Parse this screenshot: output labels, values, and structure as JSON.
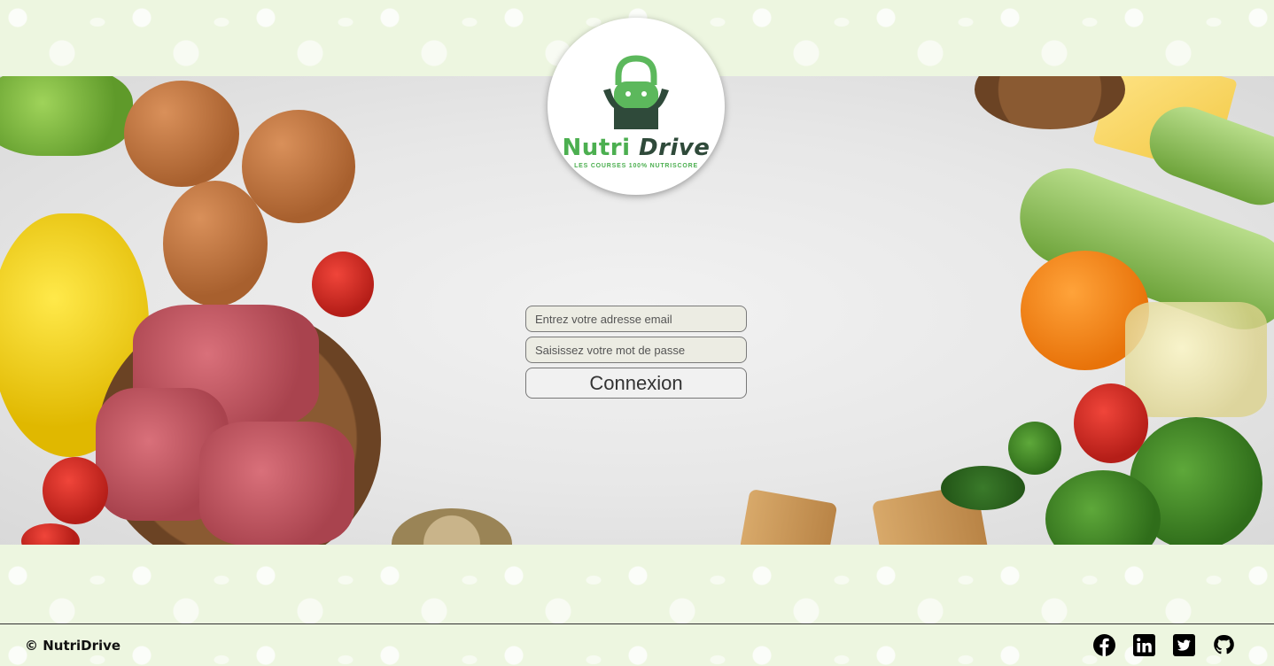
{
  "logo": {
    "brand_part1": "Nutri",
    "brand_part2": "Drive",
    "tagline": "LES COURSES 100% NUTRISCORE",
    "icon": "shopping-bag-icon",
    "colors": {
      "green": "#4caf50",
      "dark": "#2f4a3a"
    }
  },
  "login": {
    "email_placeholder": "Entrez votre adresse email",
    "password_placeholder": "Saisissez votre mot de passe",
    "submit_label": "Connexion"
  },
  "footer": {
    "copyright": "© NutriDrive",
    "socials": [
      {
        "name": "facebook-icon"
      },
      {
        "name": "linkedin-icon"
      },
      {
        "name": "twitter-icon"
      },
      {
        "name": "github-icon"
      }
    ]
  }
}
